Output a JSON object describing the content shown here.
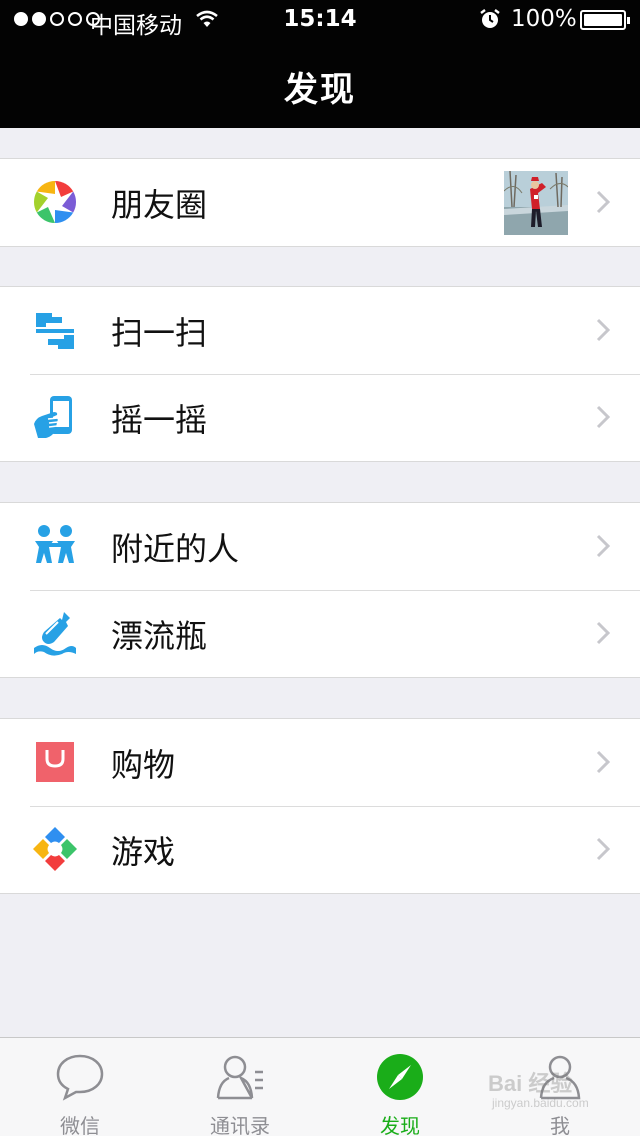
{
  "status_bar": {
    "carrier": "中国移动",
    "time": "15:14",
    "battery_percent": "100%",
    "signal_strength_dots": 2,
    "signal_total_dots": 5
  },
  "navbar": {
    "title": "发现"
  },
  "groups": [
    {
      "items": [
        {
          "label": "朋友圈",
          "icon": "aperture-icon",
          "has_thumbnail": true
        }
      ]
    },
    {
      "items": [
        {
          "label": "扫一扫",
          "icon": "scan-icon"
        },
        {
          "label": "摇一摇",
          "icon": "shake-phone-icon"
        }
      ]
    },
    {
      "items": [
        {
          "label": "附近的人",
          "icon": "people-nearby-icon"
        },
        {
          "label": "漂流瓶",
          "icon": "bottle-icon"
        }
      ]
    },
    {
      "items": [
        {
          "label": "购物",
          "icon": "shopping-bag-icon"
        },
        {
          "label": "游戏",
          "icon": "games-icon"
        }
      ]
    }
  ],
  "tabbar": {
    "tabs": [
      {
        "label": "微信",
        "icon": "chat-bubble-icon",
        "active": false
      },
      {
        "label": "通讯录",
        "icon": "contacts-icon",
        "active": false
      },
      {
        "label": "发现",
        "icon": "compass-icon",
        "active": true
      },
      {
        "label": "我",
        "icon": "person-icon",
        "active": false
      }
    ]
  },
  "watermark": {
    "text": "Bai 经验",
    "sub": "jingyan.baidu.com"
  },
  "colors": {
    "nav_background": "#030303",
    "page_background": "#efeff4",
    "active_green": "#1aad19",
    "icon_blue": "#27a1e5",
    "shopping_red": "#f0626b",
    "chevron_gray": "#c7c7cc"
  }
}
